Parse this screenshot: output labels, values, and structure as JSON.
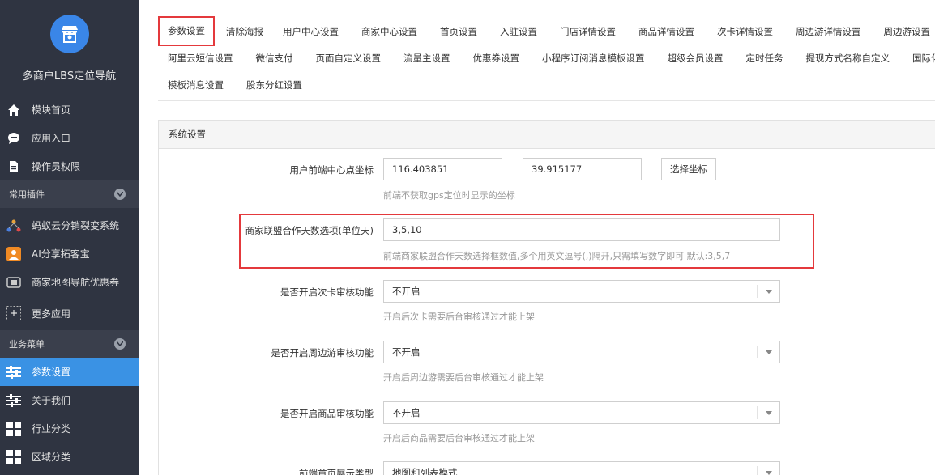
{
  "sidebar": {
    "brand_title": "多商户LBS定位导航",
    "top_items": [
      {
        "label": "模块首页",
        "icon": "home-icon"
      },
      {
        "label": "应用入口",
        "icon": "chat-icon"
      },
      {
        "label": "操作员权限",
        "icon": "document-icon"
      }
    ],
    "section1": "常用插件",
    "plugin_items": [
      {
        "label": "蚂蚁云分销裂变系统",
        "icon": "network-icon"
      },
      {
        "label": "AI分享拓客宝",
        "icon": "ai-icon"
      },
      {
        "label": "商家地图导航优惠券",
        "icon": "coupon-icon"
      },
      {
        "label": "更多应用",
        "icon": "plus-icon"
      }
    ],
    "section2": "业务菜单",
    "biz_items": [
      {
        "label": "参数设置",
        "icon": "sliders-icon"
      },
      {
        "label": "关于我们",
        "icon": "sliders-icon"
      },
      {
        "label": "行业分类",
        "icon": "grid-icon"
      },
      {
        "label": "区域分类",
        "icon": "grid-icon"
      }
    ]
  },
  "tabs": {
    "row1": [
      "参数设置",
      "清除海报",
      "用户中心设置",
      "商家中心设置",
      "首页设置",
      "入驻设置",
      "门店详情设置",
      "商品详情设置",
      "次卡详情设置",
      "周边游详情设置",
      "周边游设置"
    ],
    "row2": [
      "阿里云短信设置",
      "微信支付",
      "页面自定义设置",
      "流量主设置",
      "优惠券设置",
      "小程序订阅消息模板设置",
      "超级会员设置",
      "定时任务",
      "提现方式名称自定义",
      "国际化设置"
    ],
    "row3": [
      "模板消息设置",
      "股东分红设置"
    ]
  },
  "panel": {
    "title": "系统设置",
    "center_label": "用户前端中心点坐标",
    "lng_value": "116.403851",
    "lat_value": "39.915177",
    "choose_btn": "选择坐标",
    "center_hint": "前端不获取gps定位时显示的坐标",
    "days_label": "商家联盟合作天数选项(单位天)",
    "days_value": "3,5,10",
    "days_hint": "前端商家联盟合作天数选择框数值,多个用英文逗号(,)隔开,只需填写数字即可 默认:3,5,7",
    "card_label": "是否开启次卡审核功能",
    "card_value": "不开启",
    "card_hint": "开启后次卡需要后台审核通过才能上架",
    "tour_label": "是否开启周边游审核功能",
    "tour_value": "不开启",
    "tour_hint": "开启后周边游需要后台审核通过才能上架",
    "goods_label": "是否开启商品审核功能",
    "goods_value": "不开启",
    "goods_hint": "开启后商品需要后台审核通过才能上架",
    "display_label": "前端首页展示类型",
    "display_value": "地图和列表模式"
  },
  "colors": {
    "sidebar_bg": "#2f3441",
    "accent": "#3a92e4",
    "highlight": "#e4393c"
  }
}
